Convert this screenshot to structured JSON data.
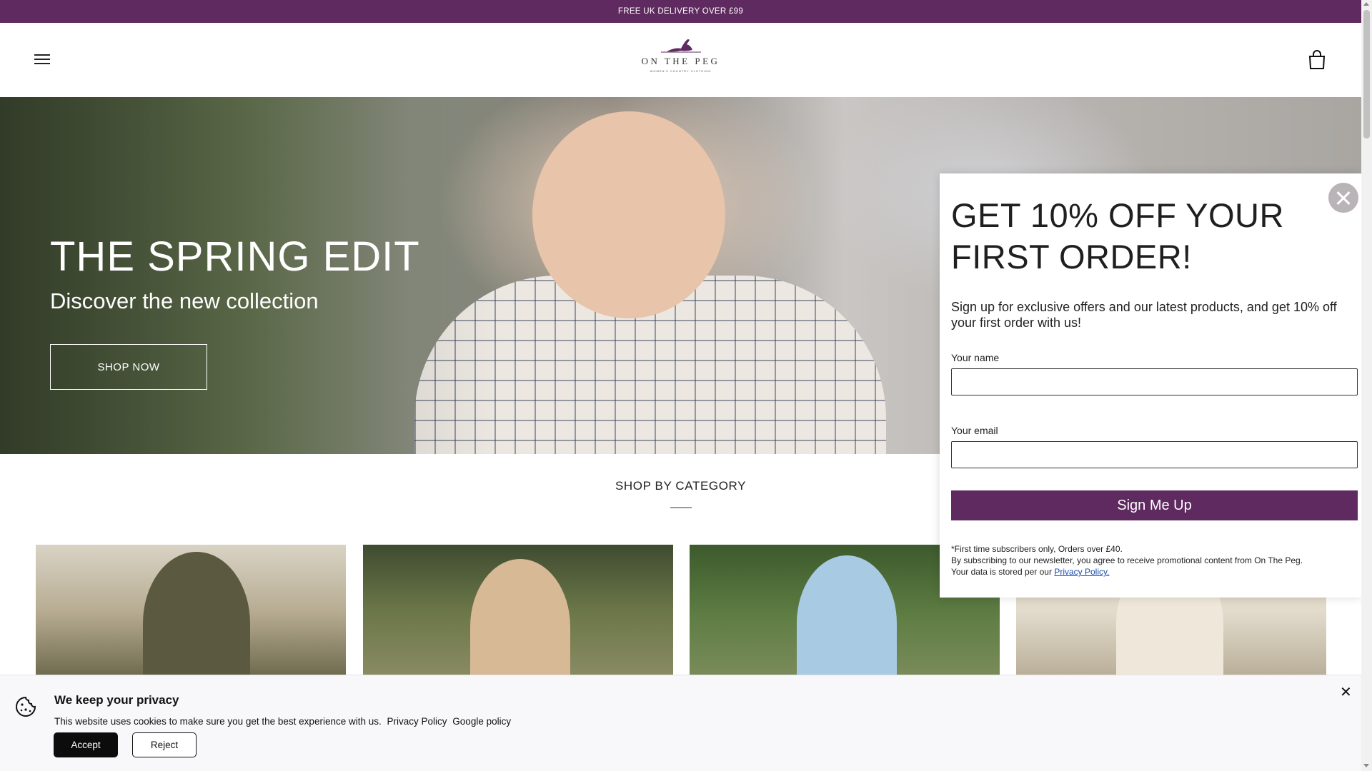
{
  "announcement": {
    "text": "FREE UK DELIVERY OVER £99"
  },
  "header": {
    "menu_icon": "hamburger-menu-icon",
    "logo_text": "ON THE PEG",
    "logo_subtext": "WOMEN'S COUNTRY CLOTHING",
    "cart_icon": "shopping-bag-icon"
  },
  "hero": {
    "title": "THE SPRING EDIT",
    "subtitle": "Discover the new collection",
    "button_label": "SHOP NOW"
  },
  "categories": {
    "title": "SHOP BY CATEGORY"
  },
  "popup": {
    "heading": "GET 10% OFF YOUR FIRST ORDER!",
    "description": "Sign up for exclusive offers and our latest products, and get 10% off your first order with us!",
    "name_label": "Your name",
    "name_value": "",
    "email_label": "Your email",
    "email_value": "",
    "button_label": "Sign Me Up",
    "fine_line1": "*First time subscribers only, Orders over £40.",
    "fine_line2": "By subscribing to our newsletter, you agree to receive promotional content from On The Peg.",
    "fine_line3": "Your data is stored per our",
    "privacy_link": "Privacy Policy.",
    "close_icon": "close-icon"
  },
  "cookie_banner": {
    "title": "We keep your privacy",
    "text": "This website uses cookies to make sure you get the best experience with us.",
    "privacy_link": "Privacy Policy",
    "google_link": "Google policy",
    "accept_label": "Accept",
    "reject_label": "Reject",
    "close_glyph": "✕",
    "icon": "cookie-icon"
  },
  "colors": {
    "brand_purple": "#5e2a5f",
    "popup_close_grey": "#b8b4b8",
    "cookie_bg": "#f8f8fb"
  }
}
